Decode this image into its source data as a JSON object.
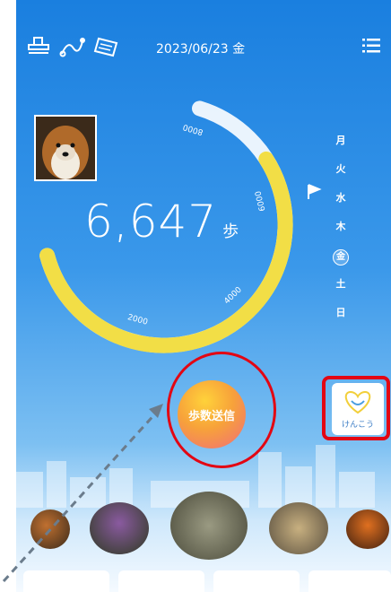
{
  "header": {
    "date": "2023/06/23 金"
  },
  "pedometer": {
    "steps": "6,647",
    "unit": "歩",
    "goal_label": "8000",
    "progress": 0.83,
    "tick_labels": [
      "2000",
      "4000",
      "6000",
      "8000"
    ]
  },
  "week": {
    "days": [
      "月",
      "火",
      "水",
      "木",
      "金",
      "土",
      "日"
    ],
    "today_index": 4
  },
  "buttons": {
    "send_steps": "歩数送信",
    "kenkou": "けんこう"
  },
  "colors": {
    "accent_yellow": "#f2de46",
    "highlight_red": "#e30613"
  }
}
